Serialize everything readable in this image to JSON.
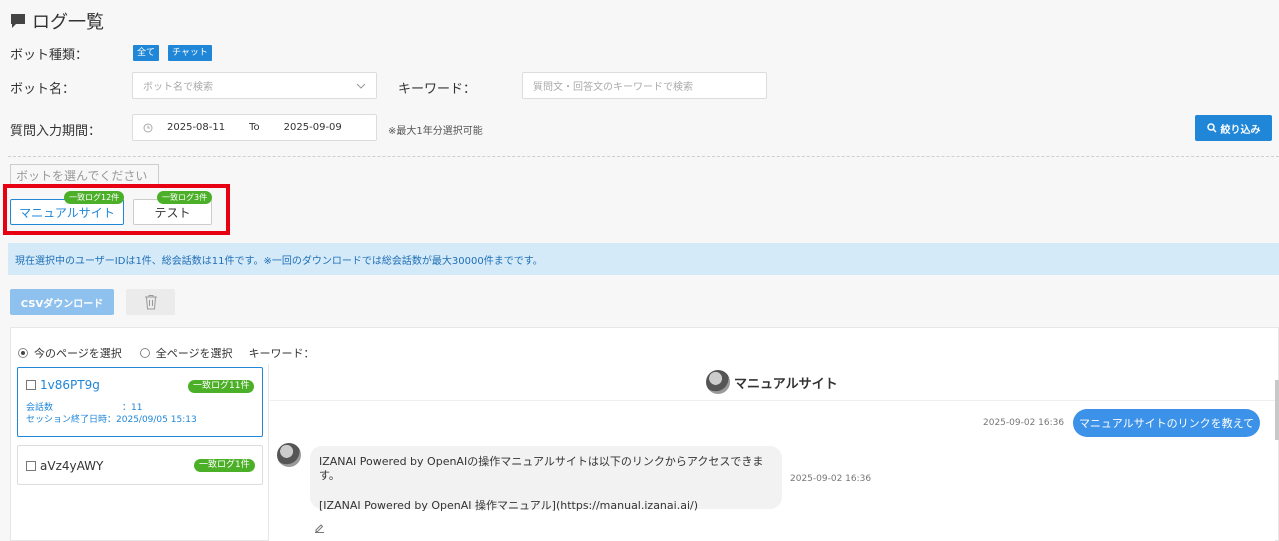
{
  "header": {
    "title": "ログ一覧"
  },
  "filters": {
    "bot_type_label": "ボット種類：",
    "bot_type_chips": [
      "全て",
      "チャット"
    ],
    "bot_name_label": "ボット名：",
    "bot_name_placeholder": "ボット名で検索",
    "keyword_label": "キーワード：",
    "keyword_placeholder": "質問文・回答文のキーワードで検索",
    "period_label": "質問入力期間：",
    "date_from": "2025-08-11",
    "date_to_label": "To",
    "date_to": "2025-09-09",
    "period_note": "※最大1年分選択可能",
    "filter_button": "絞り込み"
  },
  "bots": {
    "placeholder": "ボットを選んでください",
    "items": [
      {
        "name": "マニュアルサイト",
        "badge": "一致ログ12件",
        "selected": true
      },
      {
        "name": "テスト",
        "badge": "一致ログ3件",
        "selected": false
      }
    ]
  },
  "info_message": "現在選択中のユーザーIDは1件、総会話数は11件です。※一回のダウンロードでは総会話数が最大30000件までです。",
  "actions": {
    "csv_button": "CSVダウンロード"
  },
  "selection": {
    "current_page": "今のページを選択",
    "all_pages": "全ページを選択",
    "keyword_label": "キーワード："
  },
  "sessions": [
    {
      "id": "1v86PT9g",
      "badge": "一致ログ11件",
      "conv_label": "会話数",
      "conv_value": "：11",
      "end_label": "セッション終了日時",
      "end_value": "：2025/09/05 15:13"
    },
    {
      "id": "aVz4yAWY",
      "badge": "一致ログ1件"
    }
  ],
  "chat": {
    "bot_name": "マニュアルサイト",
    "user_time": "2025-09-02 16:36",
    "user_message": "マニュアルサイトのリンクを教えて",
    "bot_line1": "IZANAI Powered by OpenAIの操作マニュアルサイトは以下のリンクからアクセスできます。",
    "bot_line2": "[IZANAI Powered by OpenAI 操作マニュアル](https://manual.izanai.ai/)",
    "bot_time": "2025-09-02 16:36"
  },
  "colors": {
    "accent": "#1f86d8",
    "badge_green": "#4caf28",
    "highlight_red": "#e60012",
    "info_bg": "#d5eaf9"
  }
}
